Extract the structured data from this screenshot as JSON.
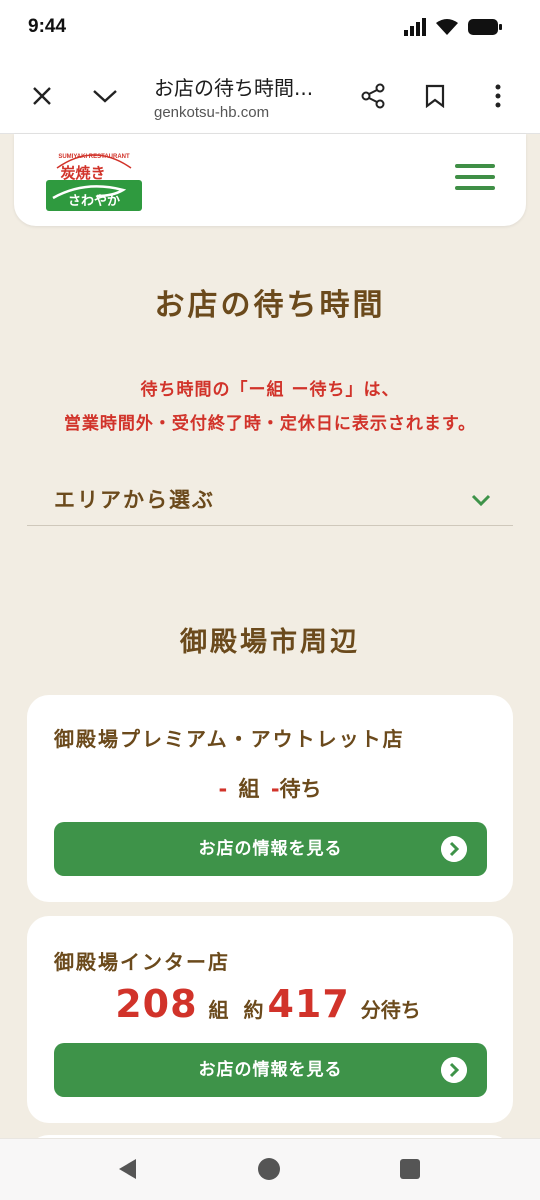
{
  "status_bar": {
    "time": "9:44"
  },
  "browser": {
    "title": "お店の待ち時間...",
    "url": "genkotsu-hb.com"
  },
  "site": {
    "logo_text": "さわやか",
    "logo_subtext": "SUMIYAKI RESTAURANT",
    "brand_color": "#3e9349"
  },
  "page": {
    "title": "お店の待ち時間",
    "notice_line1": "待ち時間の「ー組 ー待ち」は、",
    "notice_line2": "営業時間外・受付終了時・定休日に表示されます。"
  },
  "area_select": {
    "label": "エリアから選ぶ"
  },
  "region": {
    "title": "御殿場市周辺"
  },
  "stores": [
    {
      "name": "御殿場プレミアム・アウトレット店",
      "groups": "-",
      "groups_unit": "組",
      "wait": "-",
      "wait_unit": "待ち",
      "button_label": "お店の情報を見る"
    },
    {
      "name": "御殿場インター店",
      "groups": "208",
      "groups_unit": "組",
      "approx": "約",
      "wait": "417",
      "wait_unit": "分待ち",
      "button_label": "お店の情報を見る"
    }
  ],
  "colors": {
    "accent_red": "#d1332a",
    "text_brown": "#6b4a1c",
    "background": "#f2ede3"
  }
}
